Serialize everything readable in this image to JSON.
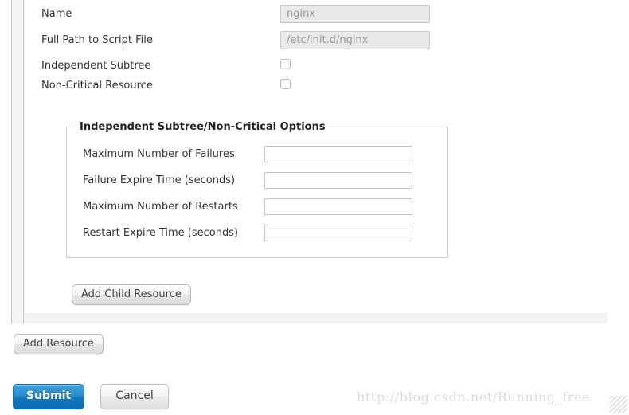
{
  "form": {
    "rows": [
      {
        "label": "Name",
        "control": "text",
        "value": "nginx"
      },
      {
        "label": "Full Path to Script File",
        "control": "text",
        "value": "/etc/init.d/nginx"
      },
      {
        "label": "Independent Subtree",
        "control": "checkbox",
        "checked": false
      },
      {
        "label": "Non-Critical Resource",
        "control": "checkbox",
        "checked": false
      }
    ]
  },
  "fieldset": {
    "legend": "Independent Subtree/Non-Critical Options",
    "rows": [
      {
        "label": "Maximum Number of Failures",
        "value": ""
      },
      {
        "label": "Failure Expire Time (seconds)",
        "value": ""
      },
      {
        "label": "Maximum Number of Restarts",
        "value": ""
      },
      {
        "label": "Restart Expire Time (seconds)",
        "value": ""
      }
    ]
  },
  "buttons": {
    "add_child_resource": "Add Child Resource",
    "add_resource": "Add Resource",
    "submit": "Submit",
    "cancel": "Cancel"
  },
  "watermark": {
    "text": "http://blog.csdn.net/Running_free"
  },
  "colors": {
    "submit_blue": "#1579be",
    "panel_background": "#ffffff",
    "rail_background": "#f4f4f4",
    "rail_border": "#c4c4c4",
    "readonly_field_background": "#e9e9e9",
    "placeholder_text": "#9a9a9a",
    "fieldset_border": "#cccccc"
  }
}
